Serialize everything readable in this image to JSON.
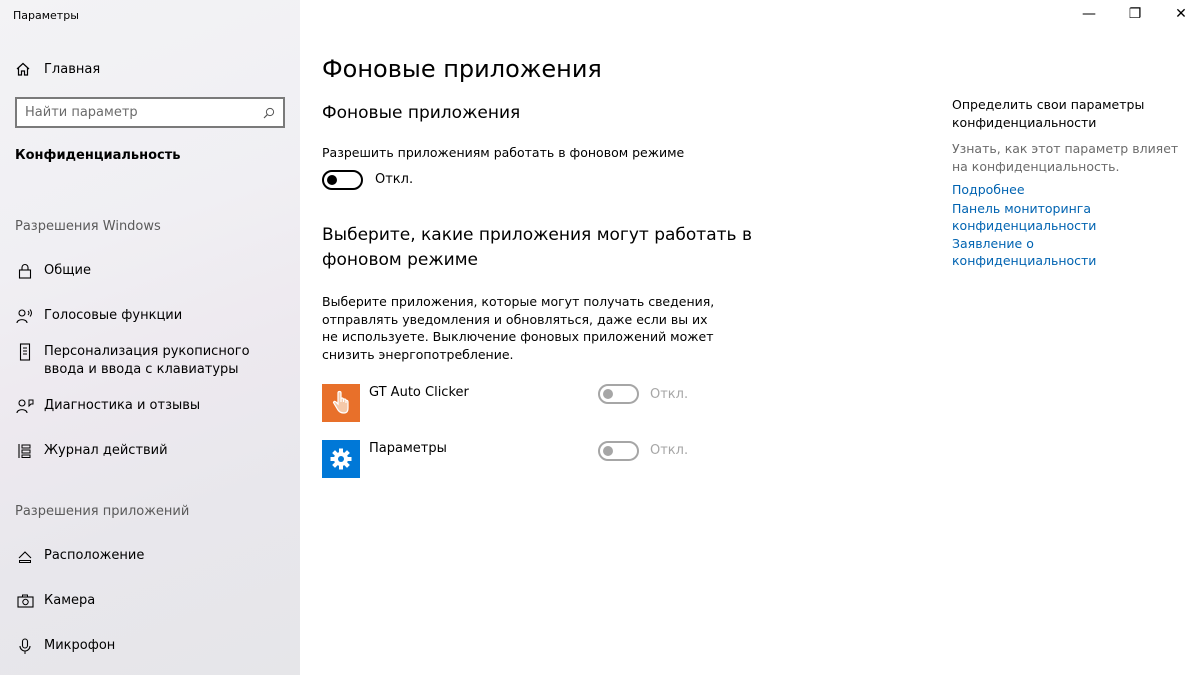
{
  "window": {
    "title": "Параметры",
    "minimize": "—",
    "maximize": "❐",
    "close": "✕"
  },
  "sidebar": {
    "home_label": "Главная",
    "search_placeholder": "Найти параметр",
    "current_section": "Конфиденциальность",
    "group_windows": "Разрешения Windows",
    "windows_items": [
      {
        "label": "Общие",
        "icon": "lock-icon"
      },
      {
        "label": "Голосовые функции",
        "icon": "voice-icon"
      },
      {
        "label": "Персонализация рукописного ввода и ввода с клавиатуры",
        "icon": "inking-icon"
      },
      {
        "label": "Диагностика и отзывы",
        "icon": "diagnostics-icon"
      },
      {
        "label": "Журнал действий",
        "icon": "activity-history-icon"
      }
    ],
    "group_apps": "Разрешения приложений",
    "app_items": [
      {
        "label": "Расположение",
        "icon": "location-icon"
      },
      {
        "label": "Камера",
        "icon": "camera-icon"
      },
      {
        "label": "Микрофон",
        "icon": "microphone-icon"
      }
    ]
  },
  "main": {
    "page_title": "Фоновые приложения",
    "section1_title": "Фоновые приложения",
    "allow_label": "Разрешить приложениям работать в фоновом режиме",
    "allow_state": "Откл.",
    "section2_title": "Выберите, какие приложения могут работать в фоновом режиме",
    "section2_desc": "Выберите приложения, которые могут получать сведения, отправлять уведомления и обновляться, даже если вы их не используете. Выключение фоновых приложений может снизить энергопотребление.",
    "apps": [
      {
        "name": "GT Auto Clicker",
        "state": "Откл.",
        "tile_color": "#e8702a",
        "icon": "hand-pointer-icon"
      },
      {
        "name": "Параметры",
        "state": "Откл.",
        "tile_color": "#0078d7",
        "icon": "gear-icon"
      }
    ]
  },
  "right": {
    "title": "Определить свои параметры конфиденциальности",
    "desc": "Узнать, как этот параметр влияет на конфиденциальность.",
    "links": [
      "Подробнее",
      "Панель мониторинга конфиденциальности",
      "Заявление о конфиденциальности"
    ]
  },
  "colors": {
    "accent_link": "#0063b1",
    "disabled": "#a6a6a6"
  }
}
